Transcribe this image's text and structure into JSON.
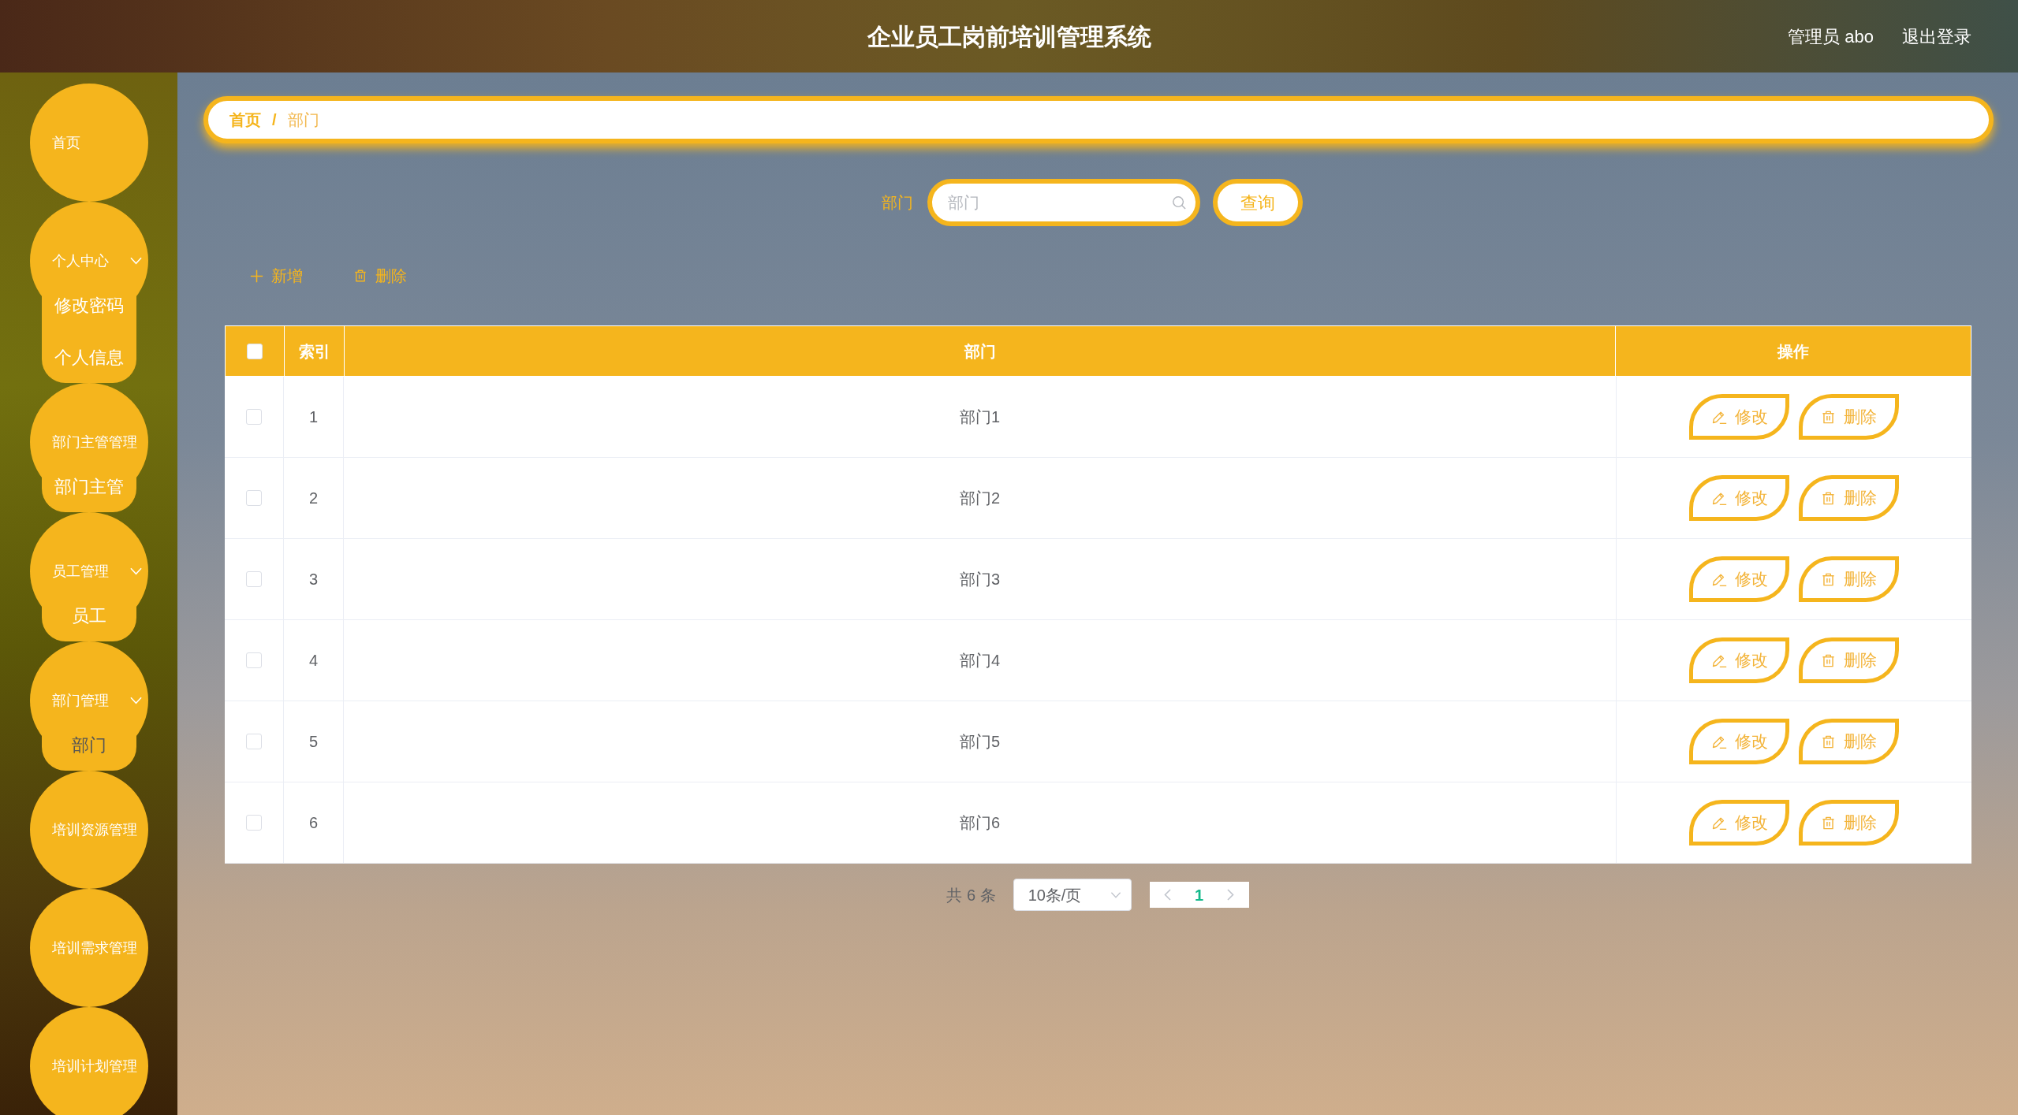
{
  "header": {
    "title": "企业员工岗前培训管理系统",
    "user": "管理员 abo",
    "logout": "退出登录"
  },
  "sidebar": {
    "items": [
      {
        "label": "首页",
        "selected": false,
        "arrow": false
      },
      {
        "label": "个人中心",
        "selected": false,
        "arrow": true,
        "children": [
          {
            "label": "修改密码",
            "selected": false
          },
          {
            "label": "个人信息",
            "selected": false
          }
        ]
      },
      {
        "label": "部门主管管理",
        "selected": false,
        "arrow": false,
        "children": [
          {
            "label": "部门主管",
            "selected": false
          }
        ]
      },
      {
        "label": "员工管理",
        "selected": false,
        "arrow": true,
        "children": [
          {
            "label": "员工",
            "selected": false
          }
        ]
      },
      {
        "label": "部门管理",
        "selected": false,
        "arrow": true,
        "children": [
          {
            "label": "部门",
            "selected": true
          }
        ]
      },
      {
        "label": "培训资源管理",
        "selected": false,
        "arrow": false
      },
      {
        "label": "培训需求管理",
        "selected": false,
        "arrow": false
      },
      {
        "label": "培训计划管理",
        "selected": false,
        "arrow": false
      }
    ]
  },
  "breadcrumb": {
    "separator": "/",
    "items": [
      {
        "label": "首页",
        "kind": "link"
      },
      {
        "label": "部门",
        "kind": "current"
      }
    ]
  },
  "search": {
    "label": "部门",
    "placeholder": "部门",
    "button": "查询"
  },
  "toolbar": [
    {
      "label": "新增",
      "kind": "add"
    },
    {
      "label": "删除",
      "kind": "delete"
    }
  ],
  "table": {
    "select_all": {
      "checked": false
    },
    "columns": [
      "索引",
      "部门",
      "操作"
    ],
    "rows": [
      {
        "checked": false,
        "index": "1",
        "name": "部门1",
        "actions": [
          {
            "label": "修改",
            "kind": "edit"
          },
          {
            "label": "删除",
            "kind": "delete"
          }
        ]
      },
      {
        "checked": false,
        "index": "2",
        "name": "部门2",
        "actions": [
          {
            "label": "修改",
            "kind": "edit"
          },
          {
            "label": "删除",
            "kind": "delete"
          }
        ]
      },
      {
        "checked": false,
        "index": "3",
        "name": "部门3",
        "actions": [
          {
            "label": "修改",
            "kind": "edit"
          },
          {
            "label": "删除",
            "kind": "delete"
          }
        ]
      },
      {
        "checked": false,
        "index": "4",
        "name": "部门4",
        "actions": [
          {
            "label": "修改",
            "kind": "edit"
          },
          {
            "label": "删除",
            "kind": "delete"
          }
        ]
      },
      {
        "checked": false,
        "index": "5",
        "name": "部门5",
        "actions": [
          {
            "label": "修改",
            "kind": "edit"
          },
          {
            "label": "删除",
            "kind": "delete"
          }
        ]
      },
      {
        "checked": false,
        "index": "6",
        "name": "部门6",
        "actions": [
          {
            "label": "修改",
            "kind": "edit"
          },
          {
            "label": "删除",
            "kind": "delete"
          }
        ]
      }
    ]
  },
  "pagination": {
    "total": "共 6 条",
    "page_size": "10条/页",
    "pages": [
      {
        "label": "1",
        "selected": true
      }
    ]
  }
}
